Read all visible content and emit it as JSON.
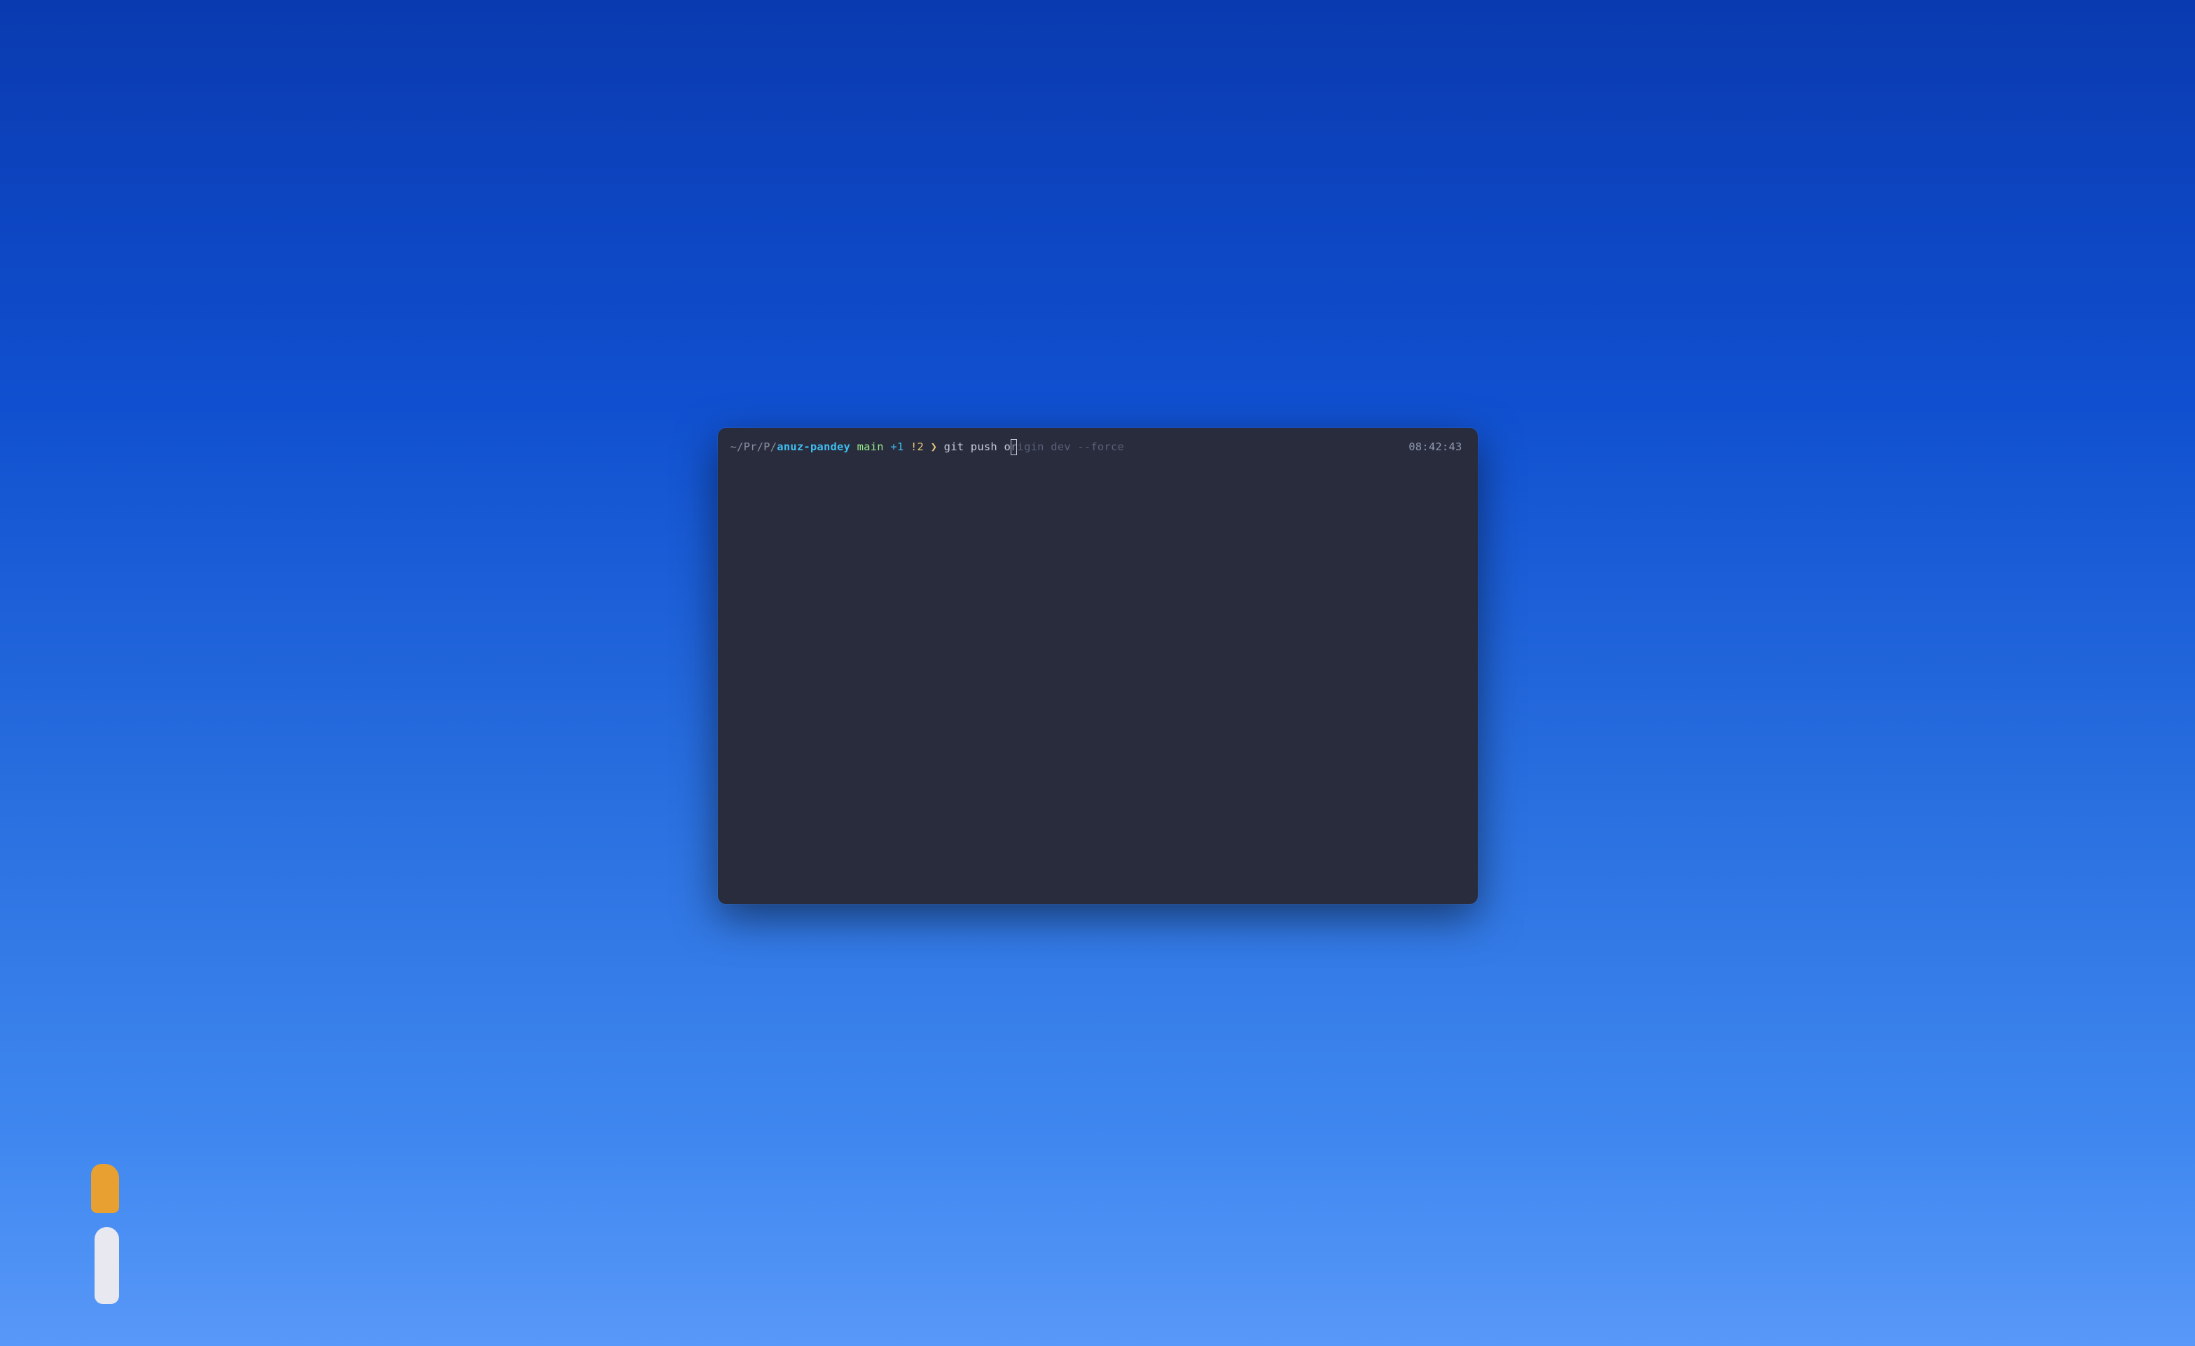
{
  "prompt": {
    "path_prefix": "~/Pr/P/",
    "path_name": "anuz-pandey",
    "branch": "main",
    "git_ahead": "+1",
    "git_dirty": "!2",
    "arrow": "❯",
    "typed_command": "git push o",
    "cursor_char": "r",
    "suggestion_rest": "igin dev --force"
  },
  "timestamp": "08:42:43"
}
